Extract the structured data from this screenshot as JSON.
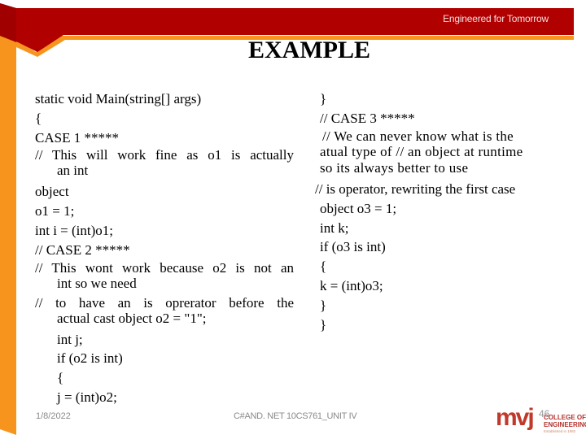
{
  "header": {
    "tagline": "Engineered for Tomorrow",
    "colors": {
      "banner": "#b00000",
      "accent": "#f7941d"
    }
  },
  "slide": {
    "title": "EXAMPLE",
    "left_column": [
      "static void Main(string[] args)",
      "{",
      "CASE 1 *****",
      "// This will work fine as o1 is actually",
      "an int",
      "object",
      "o1 = 1;",
      "int i = (int)o1;",
      "// CASE 2 *****",
      "// This wont work because o2 is not an",
      "int so we need",
      "// to have an is oprerator before the",
      "actual cast object o2 = \"1\";",
      "int j;",
      "if (o2 is int)",
      "{",
      "j = (int)o2;"
    ],
    "right_column": [
      "}",
      "// CASE 3 *****",
      "// We can never know what is the",
      "atual type of // an object at runtime",
      "so its always better to use",
      "// is operator, rewriting the first case",
      "object o3 = 1;",
      "int k;",
      "if (o3 is int)",
      "{",
      "k = (int)o3;",
      "}",
      "}"
    ]
  },
  "footer": {
    "date": "1/8/2022",
    "course": "C#AND. NET 10CS761_UNIT IV",
    "slide_number": "46",
    "logo": {
      "mark": "mvj",
      "line1": "COLLEGE OF",
      "line2": "ENGINEERING",
      "tagline": "Established in 1982"
    }
  }
}
